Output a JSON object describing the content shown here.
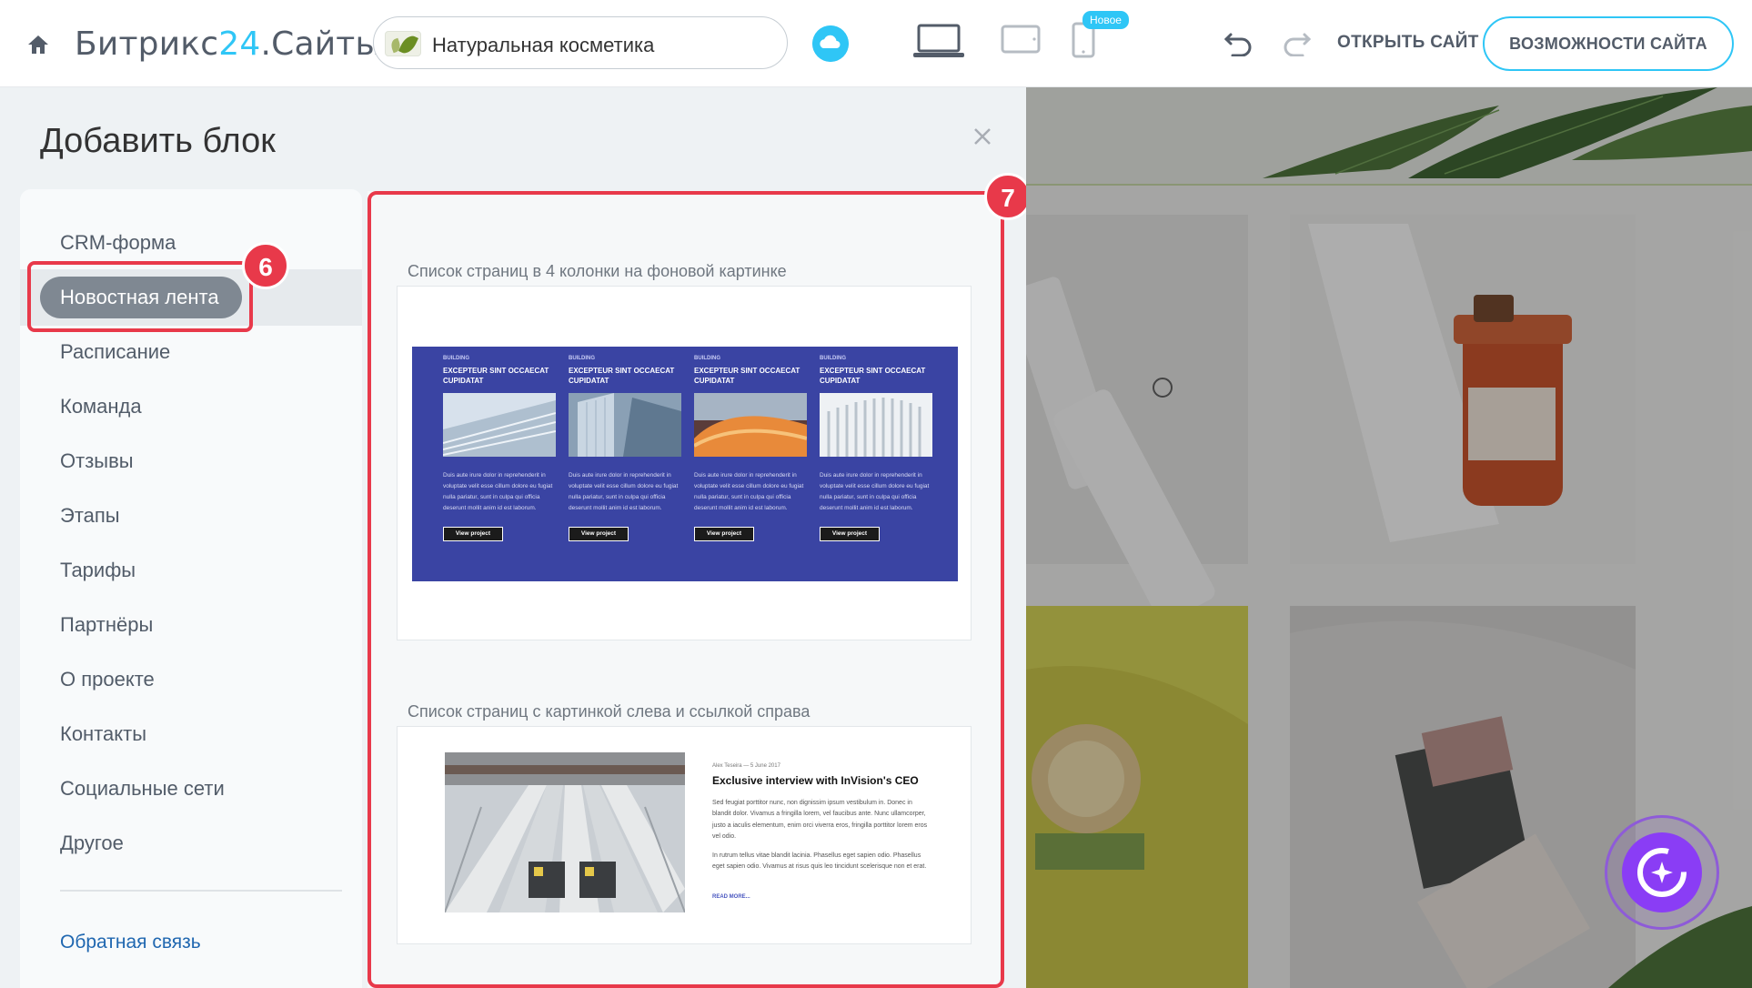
{
  "header": {
    "logo_prefix": "Битрикс",
    "logo_24": "24",
    "logo_suffix": ".Сайты",
    "site_name": "Натуральная косметика",
    "new_badge": "Новое",
    "open_site": "ОТКРЫТЬ САЙТ",
    "features": "ВОЗМОЖНОСТИ САЙТА"
  },
  "panel": {
    "title": "Добавить блок",
    "categories": [
      "CRM-форма",
      "Новостная лента",
      "Расписание",
      "Команда",
      "Отзывы",
      "Этапы",
      "Тарифы",
      "Партнёры",
      "О проекте",
      "Контакты",
      "Социальные сети",
      "Другое"
    ],
    "active_category": "Новостная лента",
    "feedback": "Обратная связь",
    "badges": [
      "6",
      "7"
    ]
  },
  "blocks": [
    {
      "title": "Список страниц в 4 колонки на фоновой картинке",
      "columns": [
        {
          "kicker": "BUILDING",
          "heading": "EXCEPTEUR SINT OCCAECAT CUPIDATAT",
          "text": "Duis aute irure dolor in reprehenderit in voluptate velit esse cillum dolore eu fugiat nulla pariatur, sunt in culpa qui officia deserunt mollit anim id est laborum.",
          "button": "View project"
        },
        {
          "kicker": "BUILDING",
          "heading": "EXCEPTEUR SINT OCCAECAT CUPIDATAT",
          "text": "Duis aute irure dolor in reprehenderit in voluptate velit esse cillum dolore eu fugiat nulla pariatur, sunt in culpa qui officia deserunt mollit anim id est laborum.",
          "button": "View project"
        },
        {
          "kicker": "BUILDING",
          "heading": "EXCEPTEUR SINT OCCAECAT CUPIDATAT",
          "text": "Duis aute irure dolor in reprehenderit in voluptate velit esse cillum dolore eu fugiat nulla pariatur, sunt in culpa qui officia deserunt mollit anim id est laborum.",
          "button": "View project"
        },
        {
          "kicker": "BUILDING",
          "heading": "EXCEPTEUR SINT OCCAECAT CUPIDATAT",
          "text": "Duis aute irure dolor in reprehenderit in voluptate velit esse cillum dolore eu fugiat nulla pariatur, sunt in culpa qui officia deserunt mollit anim id est laborum.",
          "button": "View project"
        }
      ]
    },
    {
      "title": "Список страниц с картинкой слева и ссылкой справа",
      "meta": "Alex Teseira — 5 June 2017",
      "heading": "Exclusive interview with InVision's CEO",
      "text1": "Sed feugiat porttitor nunc, non dignissim ipsum vestibulum in. Donec in blandit dolor. Vivamus a fringilla lorem, vel faucibus ante. Nunc ullamcorper, justo a iaculis elementum, enim orci viverra eros, fringilla porttitor lorem eros vel odio.",
      "text2": "In rutrum tellus vitae blandit lacinia. Phasellus eget sapien odio. Phasellus eget sapien odio. Vivamus at risus quis leo tincidunt scelerisque non et erat.",
      "read_more": "READ MORE..."
    }
  ],
  "colors": {
    "accent": "#2fc6f6",
    "highlight": "#e8394a",
    "preview_blue": "#3a44a3",
    "fab": "#8a3df5"
  }
}
